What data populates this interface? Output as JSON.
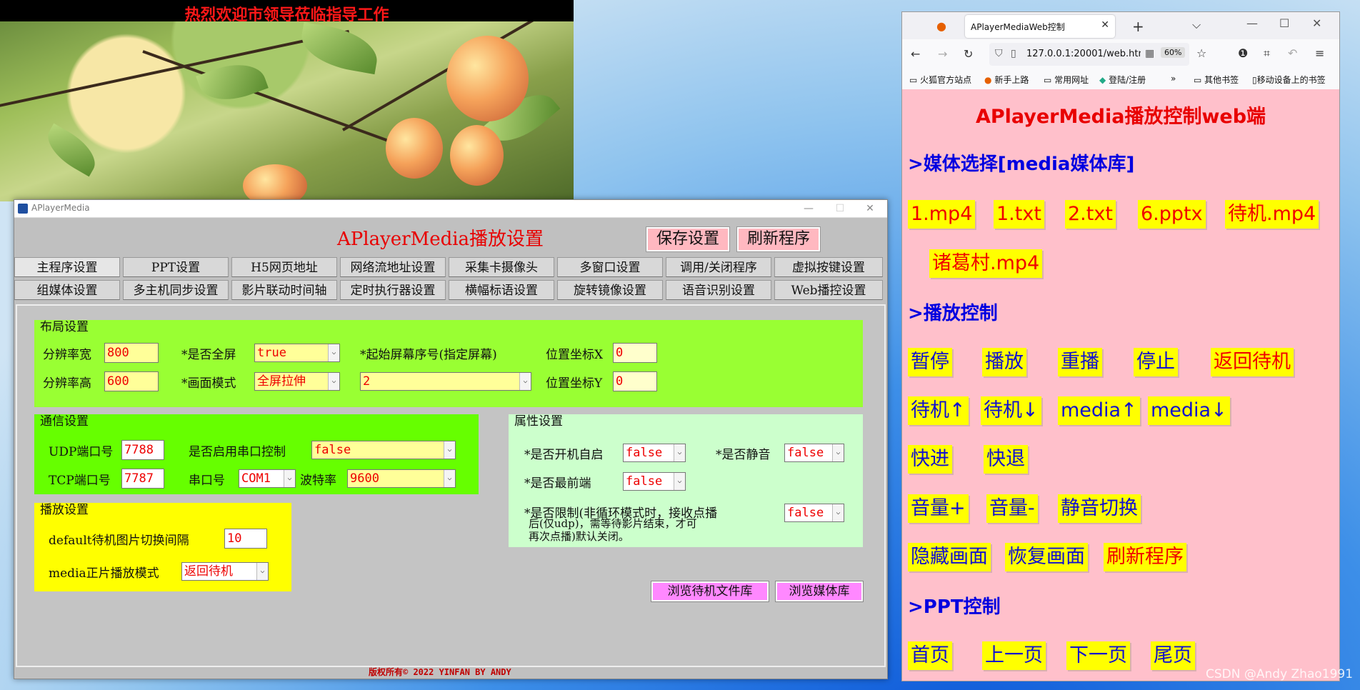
{
  "banner": {
    "text": "热烈欢迎市领导莅临指导工作"
  },
  "app": {
    "window_title": "APlayerMedia",
    "heading": "APlayerMedia播放设置",
    "save_button": "保存设置",
    "refresh_button": "刷新程序",
    "tabs_row1": [
      "主程序设置",
      "PPT设置",
      "H5网页地址",
      "网络流地址设置",
      "采集卡摄像头",
      "多窗口设置",
      "调用/关闭程序",
      "虚拟按键设置"
    ],
    "tabs_row2": [
      "组媒体设置",
      "多主机同步设置",
      "影片联动时间轴",
      "定时执行器设置",
      "横幅标语设置",
      "旋转镜像设置",
      "语音识别设置",
      "Web播控设置"
    ],
    "layout": {
      "title": "布局设置",
      "res_width_label": "分辨率宽",
      "res_width": "800",
      "res_height_label": "分辨率高",
      "res_height": "600",
      "fullscreen_label": "*是否全屏",
      "fullscreen": "true",
      "mode_label": "*画面模式",
      "mode": "全屏拉伸",
      "screen_label": "*起始屏幕序号(指定屏幕)",
      "screen": "2",
      "pos_x_label": "位置坐标X",
      "pos_x": "0",
      "pos_y_label": "位置坐标Y",
      "pos_y": "0"
    },
    "comm": {
      "title": "通信设置",
      "udp_label": "UDP端口号",
      "udp": "7788",
      "tcp_label": "TCP端口号",
      "tcp": "7787",
      "serial_enable_label": "是否启用串口控制",
      "serial_enable": "false",
      "com_label": "串口号",
      "com": "COM1",
      "baud_label": "波特率",
      "baud": "9600"
    },
    "props": {
      "title": "属性设置",
      "autostart_label": "*是否开机自启",
      "autostart": "false",
      "mute_label": "*是否静音",
      "mute": "false",
      "topmost_label": "*是否最前端",
      "topmost": "false",
      "limit_label_1": "*是否限制(非循环模式时，接收点播",
      "limit_label_2": "后(仅udp)，需等待影片结束，才可",
      "limit_label_3": "再次点播)默认关闭。",
      "limit": "false"
    },
    "play": {
      "title": "播放设置",
      "interval_label": "default待机图片切换间隔",
      "interval": "10",
      "mode_label": "media正片播放模式",
      "mode": "返回待机"
    },
    "browse_idle_button": "浏览待机文件库",
    "browse_media_button": "浏览媒体库",
    "copyright": "版权所有© 2022  YINFAN BY ANDY"
  },
  "browser": {
    "tab_title": "APlayerMediaWeb控制",
    "url": "127.0.0.1:20001/web.htm",
    "zoom": "60%",
    "bookmarks": [
      "火狐官方站点",
      "新手上路",
      "常用网址",
      "登陆/注册",
      "其他书签",
      "移动设备上的书签"
    ],
    "page": {
      "title": "APlayerMedia播放控制web端",
      "media_section": ">媒体选择[media媒体库]",
      "media_items": [
        "1.mp4",
        "1.txt",
        "2.txt",
        "6.pptx",
        "待机.mp4",
        "诸葛村.mp4"
      ],
      "play_section": ">播放控制",
      "play_buttons": [
        "暂停",
        "播放",
        "重播",
        "停止",
        "返回待机",
        "待机↑",
        "待机↓",
        "media↑",
        "media↓",
        "快进",
        "快退",
        "音量+",
        "音量-",
        "静音切换",
        "隐藏画面",
        "恢复画面",
        "刷新程序"
      ],
      "ppt_section": ">PPT控制",
      "ppt_buttons": [
        "首页",
        "上一页",
        "下一页",
        "尾页"
      ]
    }
  },
  "watermark": "CSDN @Andy Zhao1991"
}
